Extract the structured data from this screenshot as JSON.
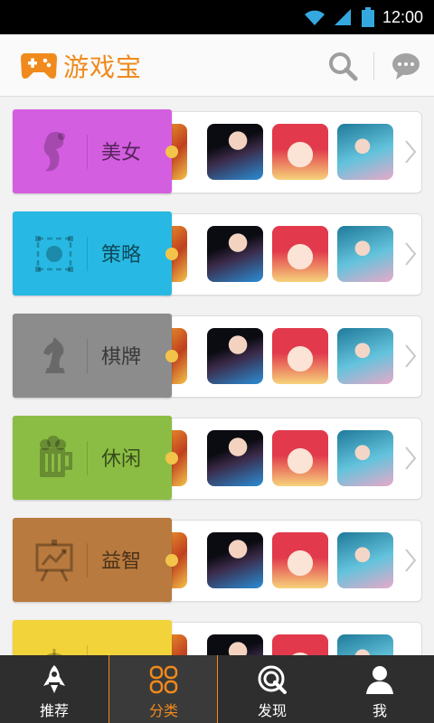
{
  "status_bar": {
    "time": "12:00",
    "icons": [
      "wifi-icon",
      "signal-icon",
      "battery-icon"
    ]
  },
  "header": {
    "title": "游戏宝",
    "icons": [
      "gamepad-logo-icon",
      "search-icon",
      "message-icon"
    ]
  },
  "colors": {
    "accent": "#f08a1c",
    "tabbar": "#2e2e2e"
  },
  "categories": [
    {
      "label": "美女",
      "color": "#d45ee0",
      "icon": "woman-icon"
    },
    {
      "label": "策略",
      "color": "#27b9e3",
      "icon": "target-grid-icon"
    },
    {
      "label": "棋牌",
      "color": "#8c8c8c",
      "icon": "chess-knight-icon"
    },
    {
      "label": "休闲",
      "color": "#8bbd44",
      "icon": "beer-mug-icon"
    },
    {
      "label": "益智",
      "color": "#b87a3e",
      "icon": "presentation-chart-icon"
    },
    {
      "label": "",
      "color": "#f2d33a",
      "icon": "crosshair-icon"
    }
  ],
  "tabbar": {
    "items": [
      {
        "label": "推荐",
        "icon": "rocket-icon",
        "active": false
      },
      {
        "label": "分类",
        "icon": "category-grid-icon",
        "active": true
      },
      {
        "label": "发现",
        "icon": "discover-icon",
        "active": false
      },
      {
        "label": "我",
        "icon": "user-icon",
        "active": false
      }
    ]
  }
}
